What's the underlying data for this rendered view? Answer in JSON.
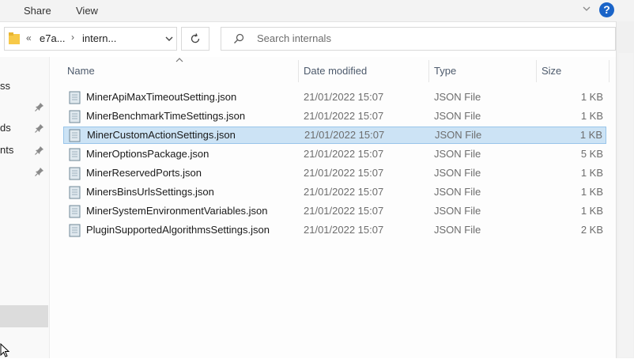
{
  "ribbon": {
    "share": "Share",
    "view": "View",
    "help": "?"
  },
  "address": {
    "overflow": "«",
    "crumb_a": "e7a...",
    "sep": "›",
    "crumb_b": "intern..."
  },
  "search": {
    "placeholder": "Search internals"
  },
  "nav": {
    "items": [
      "ss",
      "ds",
      "nts"
    ]
  },
  "columns": {
    "name": "Name",
    "date": "Date modified",
    "type": "Type",
    "size": "Size"
  },
  "files": [
    {
      "name": "MinerApiMaxTimeoutSetting.json",
      "date": "21/01/2022 15:07",
      "type": "JSON File",
      "size": "1 KB"
    },
    {
      "name": "MinerBenchmarkTimeSettings.json",
      "date": "21/01/2022 15:07",
      "type": "JSON File",
      "size": "1 KB"
    },
    {
      "name": "MinerCustomActionSettings.json",
      "date": "21/01/2022 15:07",
      "type": "JSON File",
      "size": "1 KB"
    },
    {
      "name": "MinerOptionsPackage.json",
      "date": "21/01/2022 15:07",
      "type": "JSON File",
      "size": "5 KB"
    },
    {
      "name": "MinerReservedPorts.json",
      "date": "21/01/2022 15:07",
      "type": "JSON File",
      "size": "1 KB"
    },
    {
      "name": "MinersBinsUrlsSettings.json",
      "date": "21/01/2022 15:07",
      "type": "JSON File",
      "size": "1 KB"
    },
    {
      "name": "MinerSystemEnvironmentVariables.json",
      "date": "21/01/2022 15:07",
      "type": "JSON File",
      "size": "1 KB"
    },
    {
      "name": "PluginSupportedAlgorithmsSettings.json",
      "date": "21/01/2022 15:07",
      "type": "JSON File",
      "size": "2 KB"
    }
  ],
  "selected_index": 2,
  "colors": {
    "selection_bg": "#cce3f5",
    "selection_border": "#99c5ea",
    "accent": "#1a64c8"
  }
}
